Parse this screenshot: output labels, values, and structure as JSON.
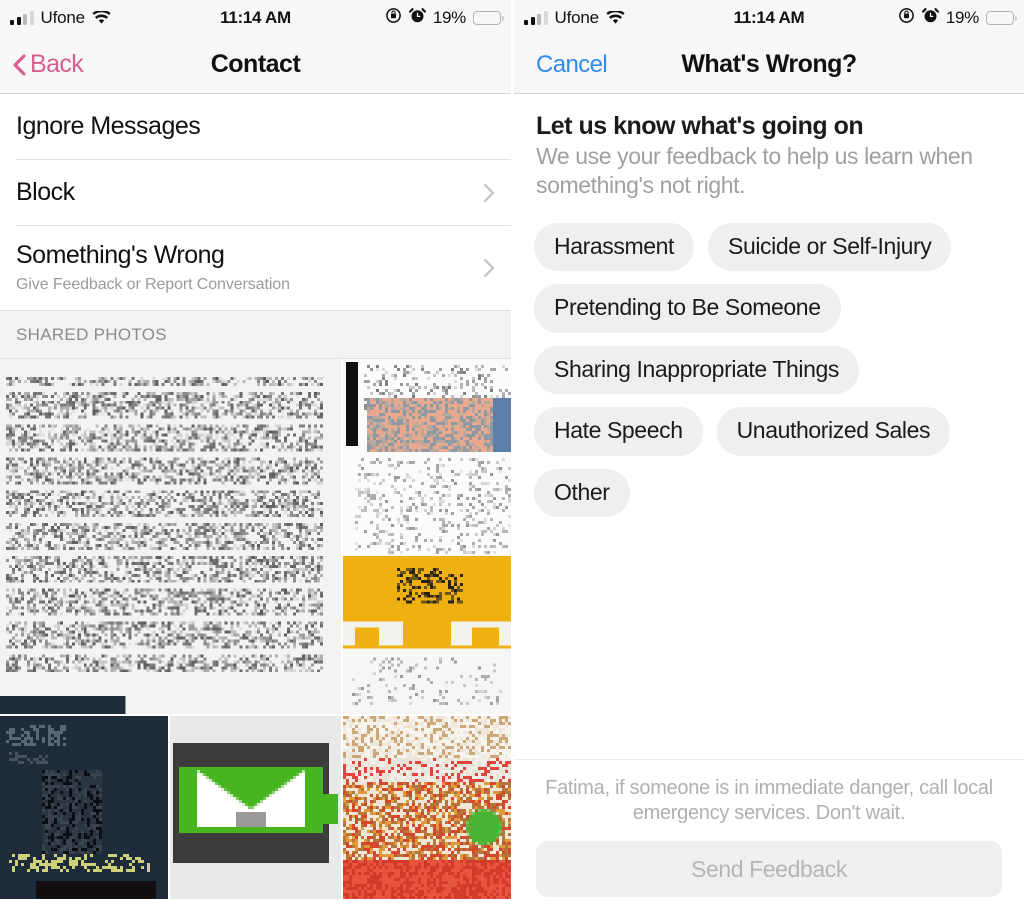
{
  "statusbar": {
    "carrier": "Ufone",
    "time": "11:14 AM",
    "battery_pct": "19%",
    "battery_level": 19,
    "icons": [
      "signal-bars-icon",
      "wifi-icon",
      "rotation-lock-icon",
      "alarm-clock-icon",
      "battery-icon"
    ],
    "battery_color": "#f4453c"
  },
  "left_screen": {
    "nav": {
      "back_label": "Back",
      "back_color": "#d6608d",
      "title": "Contact"
    },
    "rows": [
      {
        "title": "Ignore Messages",
        "subtitle": "",
        "chevron": false
      },
      {
        "title": "Block",
        "subtitle": "",
        "chevron": true
      },
      {
        "title": "Something's Wrong",
        "subtitle": "Give Feedback or Report Conversation",
        "chevron": true
      }
    ],
    "section_header": "SHARED PHOTOS"
  },
  "right_screen": {
    "nav": {
      "cancel_label": "Cancel",
      "cancel_color": "#2f8ced",
      "title": "What's Wrong?"
    },
    "intro": {
      "heading": "Let us know what's going on",
      "body": "We use your feedback to help us learn when something's not right."
    },
    "chips": [
      "Harassment",
      "Suicide or Self-Injury",
      "Pretending to Be Someone",
      "Sharing Inappropriate Things",
      "Hate Speech",
      "Unauthorized Sales",
      "Other"
    ],
    "footer": {
      "note": "Fatima, if someone is in immediate danger, call local emergency services. Don't wait.",
      "send_label": "Send Feedback"
    }
  }
}
